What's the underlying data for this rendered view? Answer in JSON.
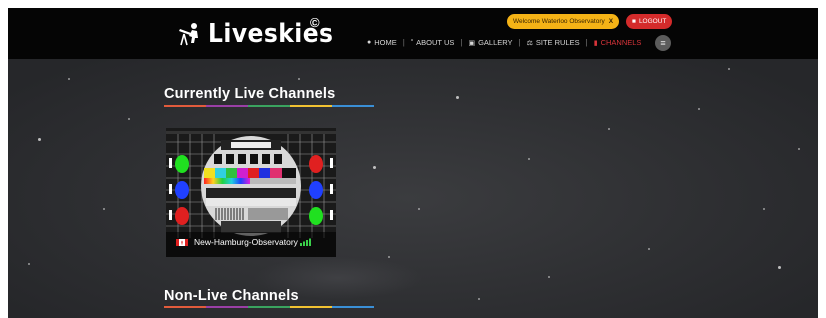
{
  "header": {
    "logo_text": "Liveskies",
    "logo_mark": "©",
    "nav": [
      {
        "label": "HOME",
        "icon": "location-pin-icon"
      },
      {
        "label": "ABOUT US",
        "icon": "quote-icon"
      },
      {
        "label": "GALLERY",
        "icon": "image-icon"
      },
      {
        "label": "SITE RULES",
        "icon": "scale-icon"
      },
      {
        "label": "CHANNELS",
        "icon": "camera-icon",
        "active": true
      }
    ],
    "welcome_label": "Welcome Waterloo Observatory",
    "welcome_close": "X",
    "logout_label": "LOGOUT",
    "menu_icon": "hamburger-icon"
  },
  "sections": {
    "live_title": "Currently Live Channels",
    "nonlive_title": "Non-Live Channels",
    "underline_colors": [
      "#e15b3c",
      "#9a3fa6",
      "#3aa35f",
      "#f1c232",
      "#3a8fd6"
    ]
  },
  "channels": [
    {
      "name": "New-Hamburg-Observatory",
      "country_flag": "canada-flag-icon",
      "live_icon": "signal-icon",
      "thumbnail": "test-pattern"
    }
  ],
  "colors": {
    "topbar": "#050505",
    "welcome_badge": "#f5b316",
    "logout_badge": "#d42b2b",
    "active_nav": "#d9343a"
  }
}
